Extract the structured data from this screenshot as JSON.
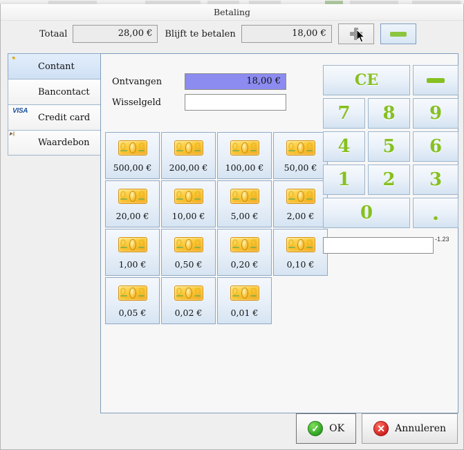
{
  "window": {
    "title": "Betaling"
  },
  "header": {
    "total_label": "Totaal",
    "total_value": "28,00 €",
    "remaining_label": "Blijft te betalen",
    "remaining_value": "18,00 €",
    "plus_button": {
      "name": "add-payment-line",
      "icon": "plus-icon",
      "enabled": false
    },
    "minus_button": {
      "name": "remove-payment-line",
      "icon": "minus-icon",
      "enabled": true,
      "color": "#8cc63f"
    }
  },
  "sidebar": {
    "items": [
      {
        "label": "Contant",
        "icon": "cash-note-icon",
        "active": true
      },
      {
        "label": "Bancontact",
        "icon": "debit-card-icon",
        "active": false
      },
      {
        "label": "Credit card",
        "icon": "credit-card-icon",
        "active": false
      },
      {
        "label": "Waardebon",
        "icon": "voucher-icon",
        "active": false
      }
    ]
  },
  "panel": {
    "received_label": "Ontvangen",
    "received_value": "18,00 €",
    "received_highlight_color": "#8b8bf0",
    "change_label": "Wisselgeld",
    "change_value": "",
    "denominations": [
      {
        "label": "500,00 €",
        "icon": "cash-note-icon"
      },
      {
        "label": "200,00 €",
        "icon": "cash-note-icon"
      },
      {
        "label": "100,00 €",
        "icon": "cash-note-icon"
      },
      {
        "label": "50,00 €",
        "icon": "cash-note-icon"
      },
      {
        "label": "20,00 €",
        "icon": "cash-note-icon"
      },
      {
        "label": "10,00 €",
        "icon": "cash-note-icon"
      },
      {
        "label": "5,00 €",
        "icon": "cash-note-icon"
      },
      {
        "label": "2,00 €",
        "icon": "cash-note-icon"
      },
      {
        "label": "1,00 €",
        "icon": "cash-note-icon"
      },
      {
        "label": "0,50 €",
        "icon": "cash-note-icon"
      },
      {
        "label": "0,20 €",
        "icon": "cash-note-icon"
      },
      {
        "label": "0,10 €",
        "icon": "cash-note-icon"
      },
      {
        "label": "0,05 €",
        "icon": "cash-note-icon"
      },
      {
        "label": "0,02 €",
        "icon": "cash-note-icon"
      },
      {
        "label": "0,01 €",
        "icon": "cash-note-icon"
      }
    ]
  },
  "keypad": {
    "digit_color": "#86c020",
    "clear_label": "CE",
    "backspace_icon": "minus-icon",
    "keys": [
      "7",
      "8",
      "9",
      "4",
      "5",
      "6",
      "1",
      "2",
      "3"
    ],
    "zero_label": "0",
    "decimal_label": "."
  },
  "scratch": {
    "value": "",
    "note": "-1.23"
  },
  "footer": {
    "ok_label": "OK",
    "ok_icon": "check-circle-icon",
    "cancel_label": "Annuleren",
    "cancel_icon": "cancel-circle-icon"
  }
}
